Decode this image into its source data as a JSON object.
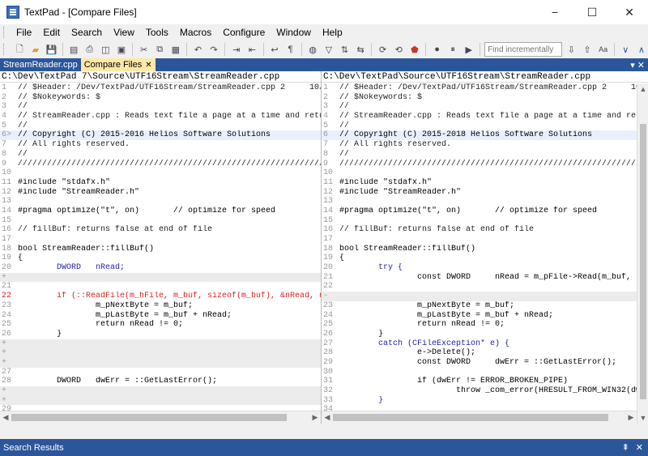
{
  "window": {
    "title": "TextPad - [Compare Files]",
    "minimize": "−",
    "maximize": "☐",
    "close": "✕"
  },
  "menu": [
    "File",
    "Edit",
    "Search",
    "View",
    "Tools",
    "Macros",
    "Configure",
    "Window",
    "Help"
  ],
  "toolbar": {
    "find_placeholder": "Find incrementally",
    "case_label": "Aa"
  },
  "tabs": [
    {
      "label": "StreamReader.cpp",
      "active": false
    },
    {
      "label": "Compare Files",
      "active": true
    }
  ],
  "tab_close": "✕",
  "tabbar_right": [
    "▾",
    "✕"
  ],
  "left_pane": {
    "path": "C:\\Dev\\TextPad 7\\Source\\UTF16Stream\\StreamReader.cpp",
    "lines": [
      {
        "n": "1",
        "t": "// $Header: /Dev/TextPad/UTF16Stream/StreamReader.cpp 2     10/",
        "c": "comment"
      },
      {
        "n": "2",
        "t": "// $Nokeywords: $",
        "c": "comment"
      },
      {
        "n": "3",
        "t": "//",
        "c": "comment"
      },
      {
        "n": "4",
        "t": "// StreamReader.cpp : Reads text file a page at a time and retu",
        "c": "comment"
      },
      {
        "n": "5",
        "t": "//",
        "c": "comment"
      },
      {
        "n": "6>",
        "t": "// Copyright (C) 2015-2016 Helios Software Solutions",
        "c": "copy"
      },
      {
        "n": "7",
        "t": "// All rights reserved.",
        "c": "comment"
      },
      {
        "n": "8",
        "t": "//",
        "c": "comment"
      },
      {
        "n": "9",
        "t": "/////////////////////////////////////////////////////////////////",
        "c": "comment"
      },
      {
        "n": "10",
        "t": "",
        "c": ""
      },
      {
        "n": "11",
        "t": "#include \"stdafx.h\"",
        "c": ""
      },
      {
        "n": "12",
        "t": "#include \"StreamReader.h\"",
        "c": ""
      },
      {
        "n": "13",
        "t": "",
        "c": ""
      },
      {
        "n": "14",
        "t": "#pragma optimize(\"t\", on)       // optimize for speed",
        "c": ""
      },
      {
        "n": "15",
        "t": "",
        "c": ""
      },
      {
        "n": "16",
        "t": "// fillBuf: returns false at end of file",
        "c": "comment"
      },
      {
        "n": "17",
        "t": "",
        "c": ""
      },
      {
        "n": "18",
        "t": "bool StreamReader::fillBuf()",
        "c": ""
      },
      {
        "n": "19",
        "t": "{",
        "c": ""
      },
      {
        "n": "20",
        "t": "        DWORD   nRead;",
        "c": "kw"
      },
      {
        "n": "+",
        "t": "",
        "c": "gap"
      },
      {
        "n": "21",
        "t": "",
        "c": ""
      },
      {
        "n": "22",
        "t": "        if (::ReadFile(m_hFile, m_buf, sizeof(m_buf), &nRead, n",
        "c": "changed"
      },
      {
        "n": "23",
        "t": "                m_pNextByte = m_buf;",
        "c": ""
      },
      {
        "n": "24",
        "t": "                m_pLastByte = m_buf + nRead;",
        "c": ""
      },
      {
        "n": "25",
        "t": "                return nRead != 0;",
        "c": ""
      },
      {
        "n": "26",
        "t": "        }",
        "c": ""
      },
      {
        "n": "+",
        "t": "",
        "c": "gap"
      },
      {
        "n": "+",
        "t": "",
        "c": "gap"
      },
      {
        "n": "+",
        "t": "",
        "c": "gap"
      },
      {
        "n": "27",
        "t": "",
        "c": ""
      },
      {
        "n": "28",
        "t": "        DWORD   dwErr = ::GetLastError();",
        "c": ""
      },
      {
        "n": "+",
        "t": "",
        "c": "gap"
      },
      {
        "n": "+",
        "t": "",
        "c": "gap"
      },
      {
        "n": "29",
        "t": "",
        "c": ""
      }
    ]
  },
  "right_pane": {
    "path": "C:\\Dev\\TextPad\\Source\\UTF16Stream\\StreamReader.cpp",
    "lines": [
      {
        "n": "1",
        "t": "// $Header: /Dev/TextPad/UTF16Stream/StreamReader.cpp 2     10/",
        "c": "comment"
      },
      {
        "n": "2",
        "t": "// $Nokeywords: $",
        "c": "comment"
      },
      {
        "n": "3",
        "t": "//",
        "c": "comment"
      },
      {
        "n": "4",
        "t": "// StreamReader.cpp : Reads text file a page at a time and retu",
        "c": "comment"
      },
      {
        "n": "5",
        "t": "//",
        "c": "comment"
      },
      {
        "n": "6",
        "t": "// Copyright (C) 2015-2018 Helios Software Solutions",
        "c": "copy"
      },
      {
        "n": "7",
        "t": "// All rights reserved.",
        "c": "comment"
      },
      {
        "n": "8",
        "t": "//",
        "c": "comment"
      },
      {
        "n": "9",
        "t": "/////////////////////////////////////////////////////////////////",
        "c": "comment"
      },
      {
        "n": "10",
        "t": "",
        "c": ""
      },
      {
        "n": "11",
        "t": "#include \"stdafx.h\"",
        "c": ""
      },
      {
        "n": "12",
        "t": "#include \"StreamReader.h\"",
        "c": ""
      },
      {
        "n": "13",
        "t": "",
        "c": ""
      },
      {
        "n": "14",
        "t": "#pragma optimize(\"t\", on)       // optimize for speed",
        "c": ""
      },
      {
        "n": "15",
        "t": "",
        "c": ""
      },
      {
        "n": "16",
        "t": "// fillBuf: returns false at end of file",
        "c": "comment"
      },
      {
        "n": "17",
        "t": "",
        "c": ""
      },
      {
        "n": "18",
        "t": "bool StreamReader::fillBuf()",
        "c": ""
      },
      {
        "n": "19",
        "t": "{",
        "c": ""
      },
      {
        "n": "20",
        "t": "        try {",
        "c": "kw"
      },
      {
        "n": "21",
        "t": "                const DWORD     nRead = m_pFile->Read(m_buf, si",
        "c": ""
      },
      {
        "n": "22",
        "t": "",
        "c": ""
      },
      {
        "n": "-",
        "t": "",
        "c": "gap"
      },
      {
        "n": "23",
        "t": "                m_pNextByte = m_buf;",
        "c": ""
      },
      {
        "n": "24",
        "t": "                m_pLastByte = m_buf + nRead;",
        "c": ""
      },
      {
        "n": "25",
        "t": "                return nRead != 0;",
        "c": ""
      },
      {
        "n": "26",
        "t": "        }",
        "c": ""
      },
      {
        "n": "27",
        "t": "        catch (CFileException* e) {",
        "c": "kw"
      },
      {
        "n": "28",
        "t": "                e->Delete();",
        "c": ""
      },
      {
        "n": "29",
        "t": "                const DWORD     dwErr = ::GetLastError();",
        "c": ""
      },
      {
        "n": "30",
        "t": "",
        "c": ""
      },
      {
        "n": "31",
        "t": "                if (dwErr != ERROR_BROKEN_PIPE)",
        "c": ""
      },
      {
        "n": "32",
        "t": "                        throw _com_error(HRESULT_FROM_WIN32(dwE",
        "c": ""
      },
      {
        "n": "33",
        "t": "        }",
        "c": "kw"
      },
      {
        "n": "34",
        "t": "",
        "c": ""
      }
    ]
  },
  "search_results": {
    "title": "Search Results",
    "pin": "⇞",
    "close": "✕"
  }
}
